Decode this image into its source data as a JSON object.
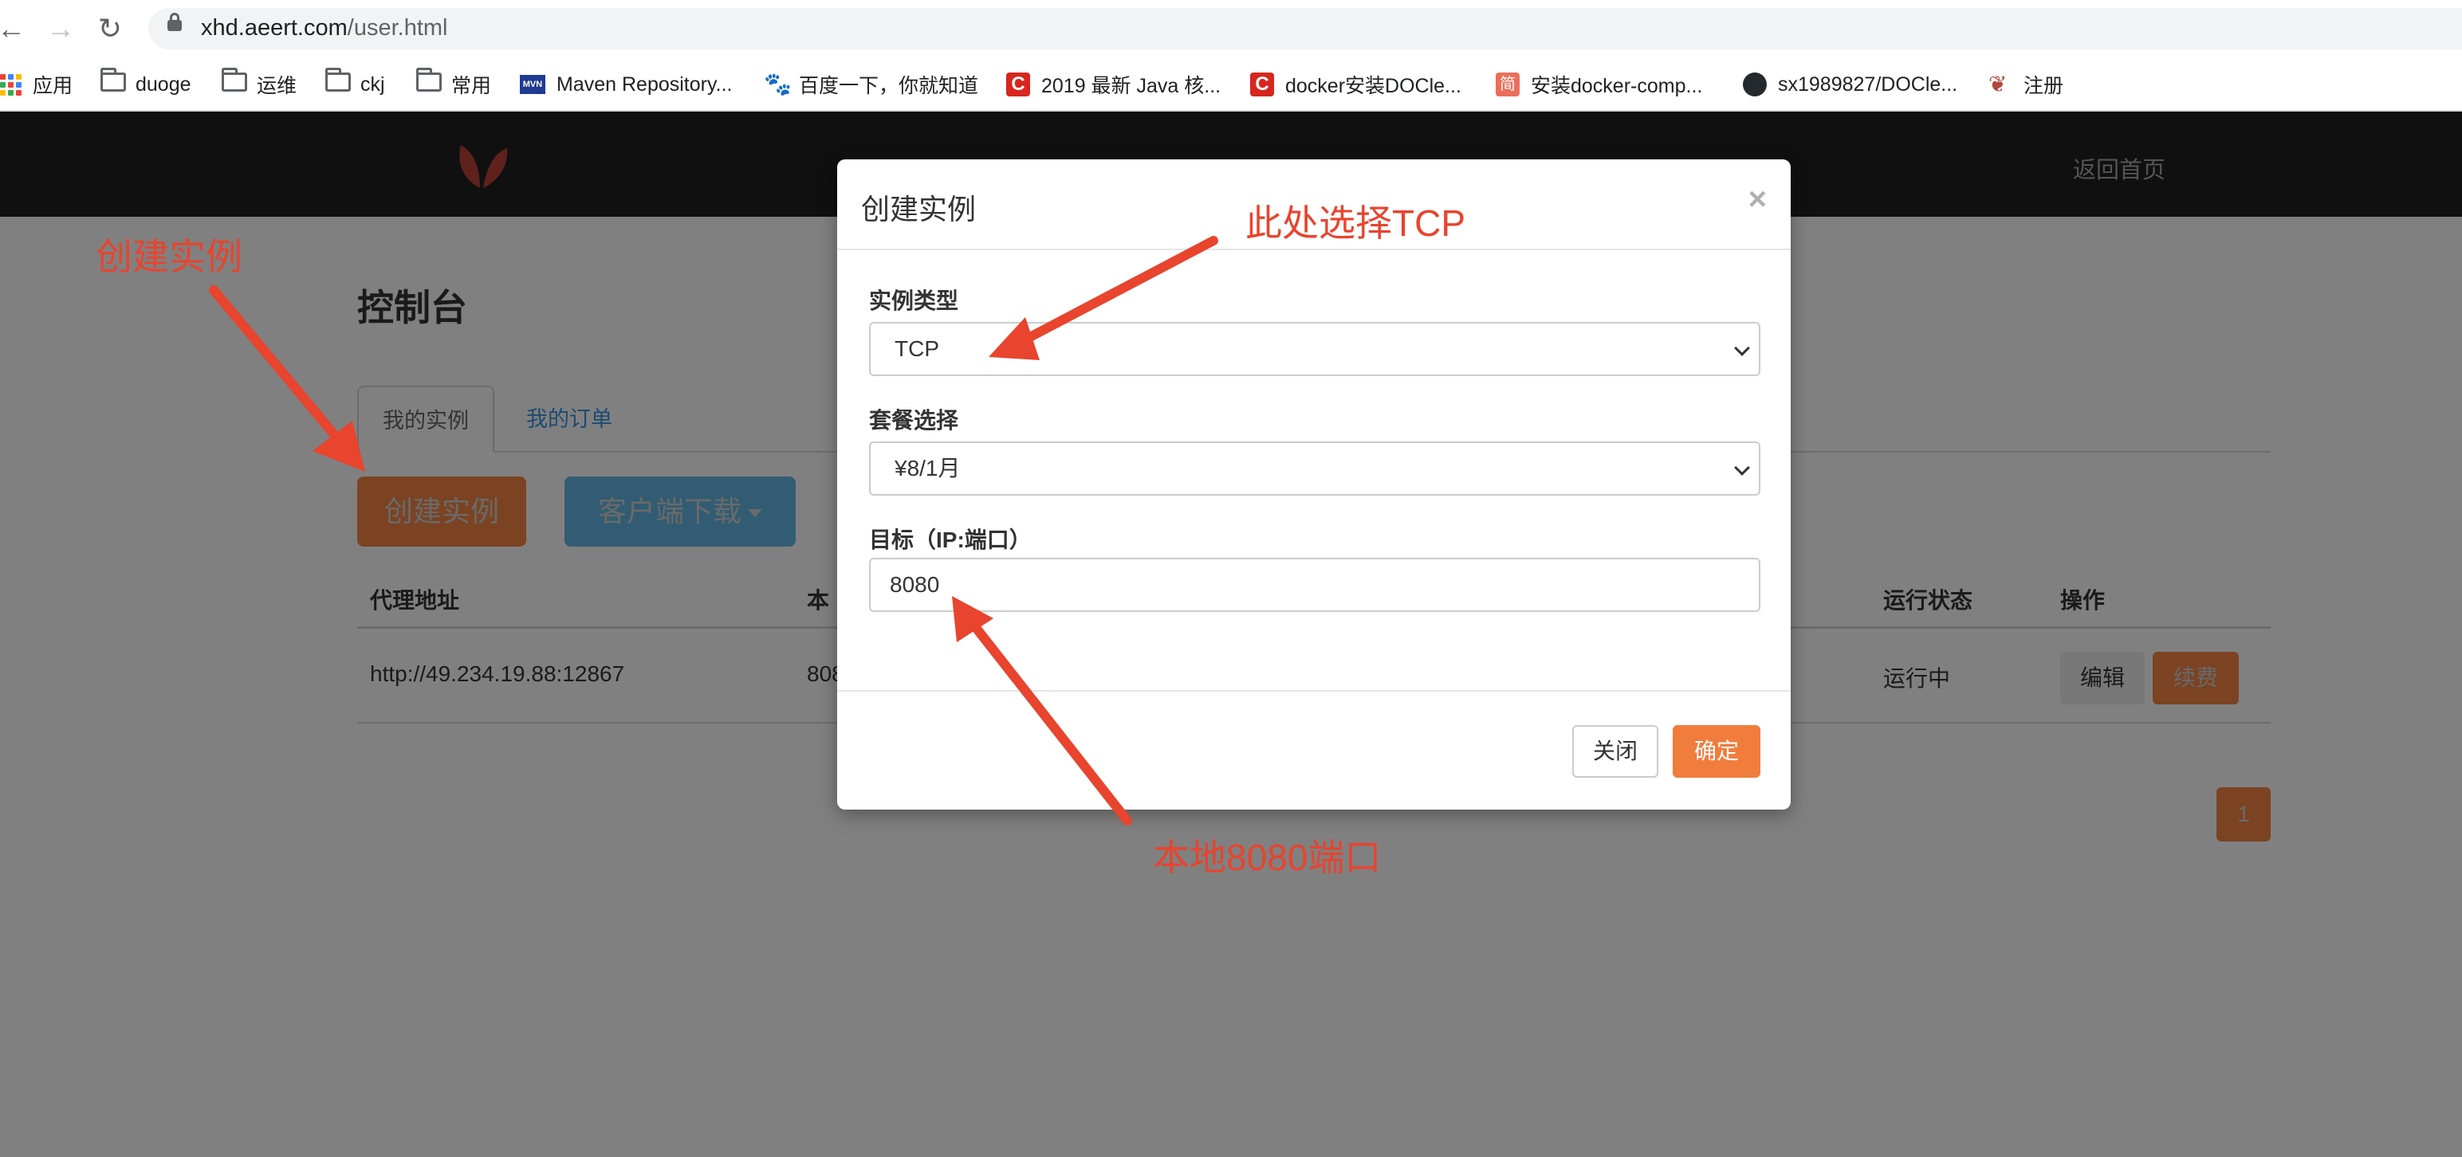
{
  "browser": {
    "url_domain": "xhd.aeert.com",
    "url_path": "/user.html",
    "back_glyph": "←",
    "forward_glyph": "→",
    "reload_glyph": "↻",
    "bookmarks": [
      {
        "label": "应用",
        "icon": "apps-icon"
      },
      {
        "label": "duoge",
        "icon": "folder-icon"
      },
      {
        "label": "运维",
        "icon": "folder-icon"
      },
      {
        "label": "ckj",
        "icon": "folder-icon"
      },
      {
        "label": "常用",
        "icon": "folder-icon"
      },
      {
        "label": "Maven Repository...",
        "icon": "maven-icon"
      },
      {
        "label": "百度一下，你就知道",
        "icon": "baidu-icon"
      },
      {
        "label": "2019 最新 Java 核...",
        "icon": "csdn-icon"
      },
      {
        "label": "docker安装DOCle...",
        "icon": "csdn-icon"
      },
      {
        "label": "安装docker-comp...",
        "icon": "jianshu-icon"
      },
      {
        "label": "sx1989827/DOCle...",
        "icon": "github-icon"
      },
      {
        "label": "注册",
        "icon": "site-logo-icon"
      }
    ]
  },
  "header": {
    "home_link": "返回首页"
  },
  "page": {
    "title": "控制台",
    "tabs": [
      {
        "label": "我的实例",
        "active": true
      },
      {
        "label": "我的订单",
        "active": false
      }
    ],
    "create_button": "创建实例",
    "download_button": "客户端下载",
    "table": {
      "headers": [
        "代理地址",
        "本",
        "运行状态",
        "操作"
      ],
      "rows": [
        {
          "proxy": "http://49.234.19.88:12867",
          "local": "808",
          "status": "运行中",
          "edit": "编辑",
          "renew": "续费"
        }
      ]
    },
    "pagination": {
      "current": "1"
    }
  },
  "modal": {
    "title": "创建实例",
    "close_glyph": "×",
    "fields": {
      "type_label": "实例类型",
      "type_value": "TCP",
      "package_label": "套餐选择",
      "package_value": "¥8/1月",
      "target_label": "目标（IP:端口）",
      "target_value": "8080"
    },
    "close_button": "关闭",
    "confirm_button": "确定"
  },
  "annotations": {
    "create_instance": "创建实例",
    "select_tcp": "此处选择TCP",
    "local_port": "本地8080端口",
    "color": "#e8442e"
  }
}
